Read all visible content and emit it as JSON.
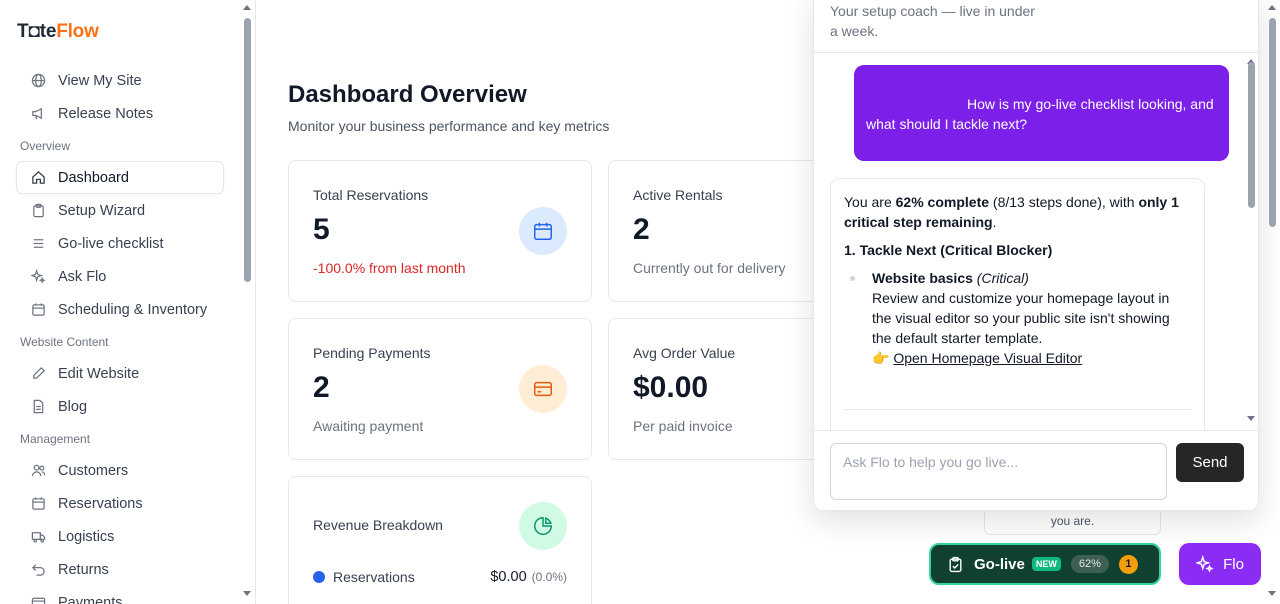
{
  "brand": {
    "part1": "T",
    "part1b": "teFlow",
    "part2": ""
  },
  "sidebar": {
    "top_items": [
      {
        "label": "View My Site",
        "icon": "globe-icon"
      },
      {
        "label": "Release Notes",
        "icon": "megaphone-icon"
      }
    ],
    "sections": [
      {
        "title": "Overview",
        "items": [
          {
            "label": "Dashboard",
            "icon": "home-icon",
            "active": true
          },
          {
            "label": "Setup Wizard",
            "icon": "clipboard-icon"
          },
          {
            "label": "Go-live checklist",
            "icon": "list-icon"
          },
          {
            "label": "Ask Flo",
            "icon": "sparkle-icon"
          },
          {
            "label": "Scheduling & Inventory",
            "icon": "calendar-icon"
          }
        ]
      },
      {
        "title": "Website Content",
        "items": [
          {
            "label": "Edit Website",
            "icon": "pen-icon"
          },
          {
            "label": "Blog",
            "icon": "document-icon"
          }
        ]
      },
      {
        "title": "Management",
        "items": [
          {
            "label": "Customers",
            "icon": "users-icon"
          },
          {
            "label": "Reservations",
            "icon": "calendar-icon"
          },
          {
            "label": "Logistics",
            "icon": "truck-icon"
          },
          {
            "label": "Returns",
            "icon": "return-icon"
          },
          {
            "label": "Payments",
            "icon": "card-icon"
          }
        ]
      }
    ]
  },
  "main": {
    "title": "Dashboard Overview",
    "subtitle": "Monitor your business performance and key metrics",
    "cards": {
      "total_reservations": {
        "label": "Total Reservations",
        "value": "5",
        "sub": "-100.0% from last month"
      },
      "active_rentals": {
        "label": "Active Rentals",
        "value": "2",
        "sub": "Currently out for delivery"
      },
      "pending_payments": {
        "label": "Pending Payments",
        "value": "2",
        "sub": "Awaiting payment"
      },
      "avg_order": {
        "label": "Avg Order Value",
        "value": "$0.00",
        "sub": "Per paid invoice"
      },
      "revenue": {
        "label": "Revenue Breakdown",
        "row_label": "Reservations",
        "row_amount": "$0.00",
        "row_pct": "(0.0%)"
      }
    },
    "colors": {
      "negative": "#dc2626",
      "calendar_bg": "#dbeafe",
      "card_bg": "#ffedd5",
      "pie_bg": "#d1fae5"
    }
  },
  "chat": {
    "header_line1": "Your setup coach — live in under",
    "header_line2": "a week.",
    "user_message": "How is my go-live checklist looking, and what should I tackle next?",
    "bot": {
      "p1_a": "You are ",
      "p1_b": "62% complete",
      "p1_c": " (8/13 steps done), with ",
      "p1_d": "only 1 critical step remaining",
      "p1_e": ".",
      "heading": "1. Tackle Next (Critical Blocker)",
      "item_title": "Website basics",
      "item_tag": "(Critical)",
      "item_body": "Review and customize your homepage layout in the visual editor so your public site isn't showing the default starter template.",
      "item_emoji": "👉",
      "item_link": "Open Homepage Visual Editor"
    },
    "input_placeholder": "Ask Flo to help you go live...",
    "send_label": "Send"
  },
  "tooltip_text": "you are.",
  "golive": {
    "label": "Go-live",
    "new": "NEW",
    "percent": "62%",
    "count": "1"
  },
  "flo": {
    "label": "Flo"
  }
}
